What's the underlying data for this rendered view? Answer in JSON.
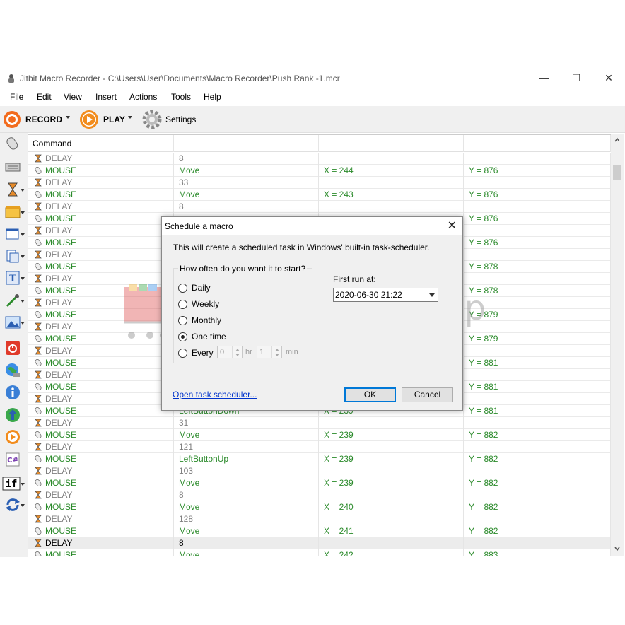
{
  "window": {
    "title": "Jitbit Macro Recorder - C:\\Users\\User\\Documents\\Macro Recorder\\Push Rank -1.mcr",
    "controls": {
      "minimize": "—",
      "maximize": "☐",
      "close": "✕"
    }
  },
  "menu": [
    "File",
    "Edit",
    "View",
    "Insert",
    "Actions",
    "Tools",
    "Help"
  ],
  "toolbar": {
    "record": "RECORD",
    "play": "PLAY",
    "settings": "Settings"
  },
  "grid": {
    "header": "Command",
    "rows": [
      {
        "type": "delay",
        "cmd": "DELAY",
        "a": "8",
        "b": "",
        "c": ""
      },
      {
        "type": "mouse",
        "cmd": "MOUSE",
        "a": "Move",
        "b": "X = 244",
        "c": "Y = 876"
      },
      {
        "type": "delay",
        "cmd": "DELAY",
        "a": "33",
        "b": "",
        "c": ""
      },
      {
        "type": "mouse",
        "cmd": "MOUSE",
        "a": "Move",
        "b": "X = 243",
        "c": "Y = 876"
      },
      {
        "type": "delay",
        "cmd": "DELAY",
        "a": "8",
        "b": "",
        "c": ""
      },
      {
        "type": "mouse",
        "cmd": "MOUSE",
        "a": "",
        "b": "",
        "c": "Y = 876"
      },
      {
        "type": "delay",
        "cmd": "DELAY",
        "a": "",
        "b": "",
        "c": ""
      },
      {
        "type": "mouse",
        "cmd": "MOUSE",
        "a": "",
        "b": "",
        "c": "Y = 876"
      },
      {
        "type": "delay",
        "cmd": "DELAY",
        "a": "",
        "b": "",
        "c": ""
      },
      {
        "type": "mouse",
        "cmd": "MOUSE",
        "a": "",
        "b": "",
        "c": "Y = 878"
      },
      {
        "type": "delay",
        "cmd": "DELAY",
        "a": "",
        "b": "",
        "c": ""
      },
      {
        "type": "mouse",
        "cmd": "MOUSE",
        "a": "",
        "b": "",
        "c": "Y = 878"
      },
      {
        "type": "delay",
        "cmd": "DELAY",
        "a": "",
        "b": "",
        "c": ""
      },
      {
        "type": "mouse",
        "cmd": "MOUSE",
        "a": "",
        "b": "",
        "c": "Y = 879"
      },
      {
        "type": "delay",
        "cmd": "DELAY",
        "a": "",
        "b": "",
        "c": ""
      },
      {
        "type": "mouse",
        "cmd": "MOUSE",
        "a": "",
        "b": "",
        "c": "Y = 879"
      },
      {
        "type": "delay",
        "cmd": "DELAY",
        "a": "",
        "b": "",
        "c": ""
      },
      {
        "type": "mouse",
        "cmd": "MOUSE",
        "a": "",
        "b": "",
        "c": "Y = 881"
      },
      {
        "type": "delay",
        "cmd": "DELAY",
        "a": "",
        "b": "",
        "c": ""
      },
      {
        "type": "mouse",
        "cmd": "MOUSE",
        "a": "",
        "b": "",
        "c": "Y = 881"
      },
      {
        "type": "delay",
        "cmd": "DELAY",
        "a": "",
        "b": "",
        "c": ""
      },
      {
        "type": "mouse",
        "cmd": "MOUSE",
        "a": "LeftButtonDown",
        "b": "X = 239",
        "c": "Y = 881"
      },
      {
        "type": "delay",
        "cmd": "DELAY",
        "a": "31",
        "b": "",
        "c": ""
      },
      {
        "type": "mouse",
        "cmd": "MOUSE",
        "a": "Move",
        "b": "X = 239",
        "c": "Y = 882"
      },
      {
        "type": "delay",
        "cmd": "DELAY",
        "a": "121",
        "b": "",
        "c": ""
      },
      {
        "type": "mouse",
        "cmd": "MOUSE",
        "a": "LeftButtonUp",
        "b": "X = 239",
        "c": "Y = 882"
      },
      {
        "type": "delay",
        "cmd": "DELAY",
        "a": "103",
        "b": "",
        "c": ""
      },
      {
        "type": "mouse",
        "cmd": "MOUSE",
        "a": "Move",
        "b": "X = 239",
        "c": "Y = 882"
      },
      {
        "type": "delay",
        "cmd": "DELAY",
        "a": "8",
        "b": "",
        "c": ""
      },
      {
        "type": "mouse",
        "cmd": "MOUSE",
        "a": "Move",
        "b": "X = 240",
        "c": "Y = 882"
      },
      {
        "type": "delay",
        "cmd": "DELAY",
        "a": "128",
        "b": "",
        "c": ""
      },
      {
        "type": "mouse",
        "cmd": "MOUSE",
        "a": "Move",
        "b": "X = 241",
        "c": "Y = 882"
      },
      {
        "type": "selected",
        "cmd": "DELAY",
        "a": "8",
        "b": "",
        "c": ""
      },
      {
        "type": "mouse",
        "cmd": "MOUSE",
        "a": "Move",
        "b": "X = 242",
        "c": "Y = 883"
      }
    ]
  },
  "watermark": "Almaftuchin Shop",
  "dialog": {
    "title": "Schedule a macro",
    "info": "This will create a scheduled task in Windows' built-in task-scheduler.",
    "group_label": "How often do you want it to start?",
    "options": [
      "Daily",
      "Weekly",
      "Monthly",
      "One time",
      "Every"
    ],
    "selected_option": "One time",
    "every_hours": "0",
    "every_hours_unit": "hr",
    "every_minutes": "1",
    "every_minutes_unit": "min",
    "first_run_label": "First run at:",
    "first_run_value": "2020-06-30  21:22",
    "link": "Open task scheduler...",
    "ok": "OK",
    "cancel": "Cancel"
  },
  "colors": {
    "mouse_text": "#2a8a2a",
    "delay_text": "#808080",
    "record_orange": "#f26b1d",
    "link_blue": "#0033cc",
    "focus_blue": "#0078d7"
  }
}
